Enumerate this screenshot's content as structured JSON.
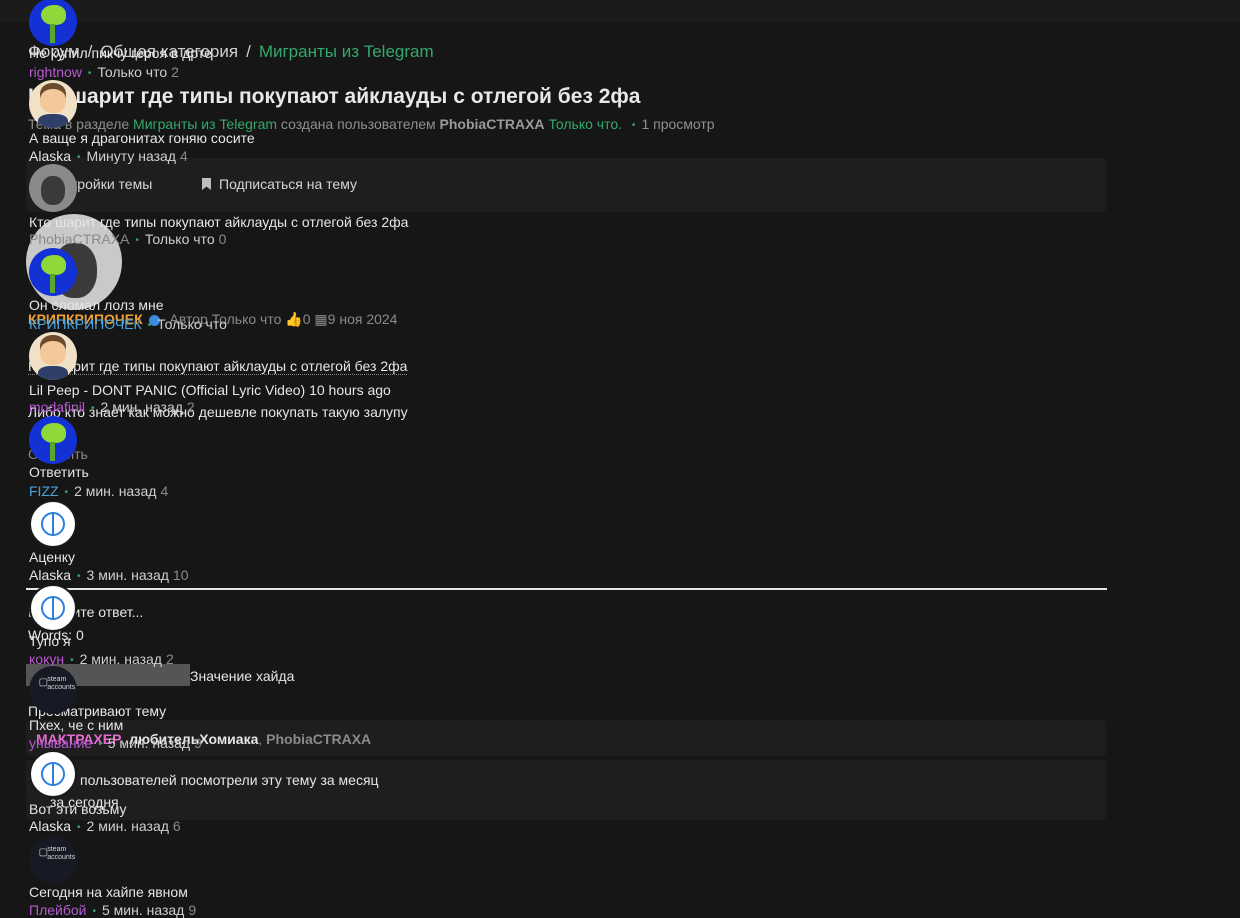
{
  "breadcrumb": {
    "items": [
      "Форум",
      "Общая категория"
    ],
    "active": "Мигранты из Telegram"
  },
  "thread": {
    "title": "Кто шарит где типы покупают айклауды с отлегой без 2фа",
    "meta_prefix": "Тема в разделе",
    "meta_section": "Мигранты из Telegram",
    "meta_created_by": "создана пользователем",
    "meta_author": "PhobiaCTRAXA",
    "meta_time": "Только что.",
    "meta_views": "1 просмотр"
  },
  "toolbar": {
    "settings": "Настройки темы",
    "subscribe": "Подписаться на тему"
  },
  "post": {
    "author": "КРИПКРИПОЧЕК",
    "role": "Автор",
    "time": "Только что",
    "likes": "0",
    "date": "9 ноя 2024",
    "quote": "Кто шарит где типы покупают айклауды с отлегой без 2фа",
    "body": "Либо кто знает как можно дешевле покупать такую залупу",
    "reply": "Ответить"
  },
  "editor": {
    "placeholder": "Напишите ответ...",
    "words": "Words: 0",
    "hide_label": "Значение хайда"
  },
  "viewers": {
    "title": "Просматривают тему",
    "users": [
      "МАКТРАХЕР",
      "любительХомиака",
      "PhobiaCTRAXA"
    ],
    "month_text": "пользователей посмотрели эту тему за месяц",
    "today": "за сегодня"
  },
  "similar": [
    {
      "text": "Не купил пикчу героя в дрте",
      "user": "rightnow",
      "time": "Только что",
      "count": "2"
    },
    {
      "text": "А ваще я драгонитах гоняю сосите",
      "user": "Alaska",
      "time": "Минуту назад",
      "count": "4"
    },
    {
      "text": "Кто шарит где типы покупают айклауды с отлегой без 2фа",
      "user": "PhobiaCTRAXA",
      "time": "Только что",
      "count": "0"
    },
    {
      "text": "Он сломал лолз мне",
      "user": "КРИПКРИПОЧЕК",
      "time": "Только что",
      "count": ""
    },
    {
      "text": "Lil Peep - DONT PANIC (Official Lyric Video) 10 hours ago",
      "user": "modafinil",
      "time": "2 мин. назад",
      "count": "2"
    },
    {
      "text": "Ответить",
      "user": "FIZZ",
      "time": "2 мин. назад",
      "count": "4"
    },
    {
      "text": "Аценку",
      "user": "Alaska",
      "time": "3 мин. назад",
      "count": "10"
    },
    {
      "text": "Тупо я",
      "user": "кокун",
      "time": "2 мин. назад",
      "count": "2"
    },
    {
      "text": "Пхех, че с ним",
      "user": "унывание",
      "time": "5 мин. назад",
      "count": "9"
    },
    {
      "text": "Вот эти возьму",
      "user": "Alaska",
      "time": "2 мин. назад",
      "count": "6"
    },
    {
      "text": "Сегодня на хайпе явном",
      "user": "Плейбой",
      "time": "5 мин. назад",
      "count": "9"
    }
  ],
  "colors": {
    "accent": "#34a86b",
    "background": "#161616",
    "panel": "#1e1e1e",
    "purple_user": "#b75bd1",
    "blue_user": "#4aa3df"
  },
  "icons": [
    "bookmark-icon",
    "verified-icon",
    "thumbs-up-icon",
    "calendar-icon"
  ]
}
